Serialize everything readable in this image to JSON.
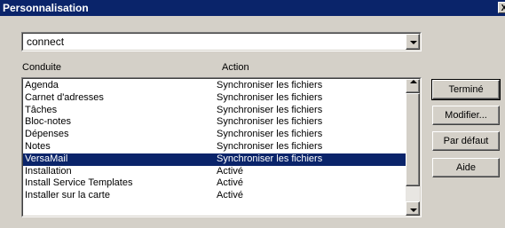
{
  "window": {
    "title": "Personnalisation",
    "close_glyph": "X"
  },
  "combo": {
    "value": "connect"
  },
  "columns": {
    "conduit": "Conduite",
    "action": "Action"
  },
  "rows": [
    {
      "name": "Agenda",
      "action": "Synchroniser les fichiers",
      "selected": false
    },
    {
      "name": "Carnet d'adresses",
      "action": "Synchroniser les fichiers",
      "selected": false
    },
    {
      "name": "Tâches",
      "action": "Synchroniser les fichiers",
      "selected": false
    },
    {
      "name": "Bloc-notes",
      "action": "Synchroniser les fichiers",
      "selected": false
    },
    {
      "name": "Dépenses",
      "action": "Synchroniser les fichiers",
      "selected": false
    },
    {
      "name": "Notes",
      "action": "Synchroniser les fichiers",
      "selected": false
    },
    {
      "name": "VersaMail",
      "action": "Synchroniser les fichiers",
      "selected": true
    },
    {
      "name": "Installation",
      "action": "Activé",
      "selected": false
    },
    {
      "name": "Install Service Templates",
      "action": "Activé",
      "selected": false
    },
    {
      "name": "Installer sur la carte",
      "action": "Activé",
      "selected": false
    }
  ],
  "buttons": {
    "done": "Terminé",
    "modify": "Modifier...",
    "default": "Par défaut",
    "help": "Aide"
  },
  "colors": {
    "titlebar": "#0a246a",
    "selection": "#0a246a",
    "face": "#d4d0c8"
  }
}
